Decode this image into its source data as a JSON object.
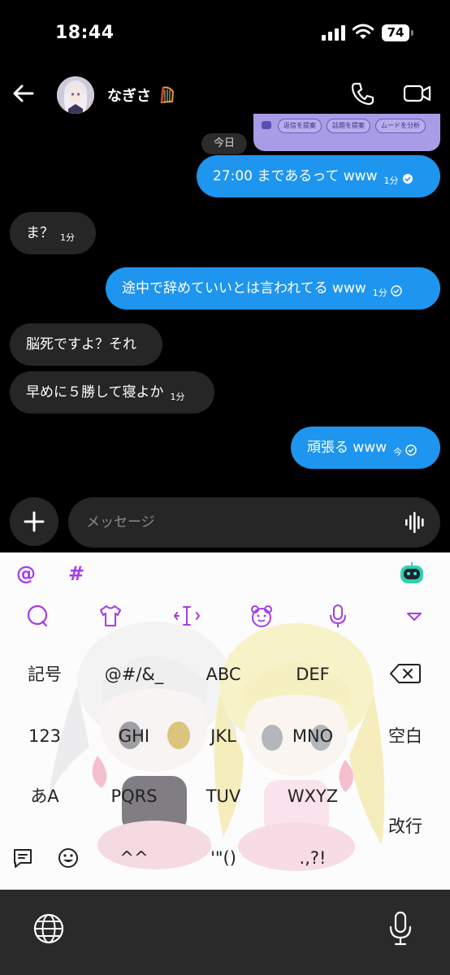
{
  "status_bar": {
    "time": "18:44",
    "battery": "74"
  },
  "header": {
    "contact_name": "なぎさ"
  },
  "ai_assist": {
    "chips": [
      "返信を提案",
      "話題を提案",
      "ムードを分析"
    ]
  },
  "chat": {
    "day_label": "今日",
    "messages": [
      {
        "direction": "out",
        "text": "27:00 まであるって www",
        "time": "1分"
      },
      {
        "direction": "in",
        "text": "ま？",
        "time": "1分"
      },
      {
        "direction": "out",
        "text": "途中で辞めていいとは言われてる www",
        "time": "1分"
      },
      {
        "direction": "in",
        "text": "脳死ですよ？それ",
        "time": ""
      },
      {
        "direction": "in",
        "text": "早めに５勝して寝よか",
        "time": "1分"
      },
      {
        "direction": "out",
        "text": "頑張る www",
        "time": "今"
      }
    ]
  },
  "composer": {
    "placeholder": "メッセージ"
  },
  "keyboard": {
    "top_symbols": [
      "@",
      "#"
    ],
    "row1": [
      "記号",
      "@#/&_",
      "ABC",
      "DEF"
    ],
    "row2": [
      "123",
      "GHI",
      "JKL",
      "MNO",
      "空白"
    ],
    "row3": [
      "あA",
      "PQRS",
      "TUV",
      "WXYZ"
    ],
    "row4": [
      "^^",
      "'\"()",
      ".,?!"
    ],
    "enter_label": "改行"
  },
  "colors": {
    "accent_purple": "#a63bea",
    "sent_bubble": "#1e95ee",
    "received_bubble": "#262626"
  }
}
